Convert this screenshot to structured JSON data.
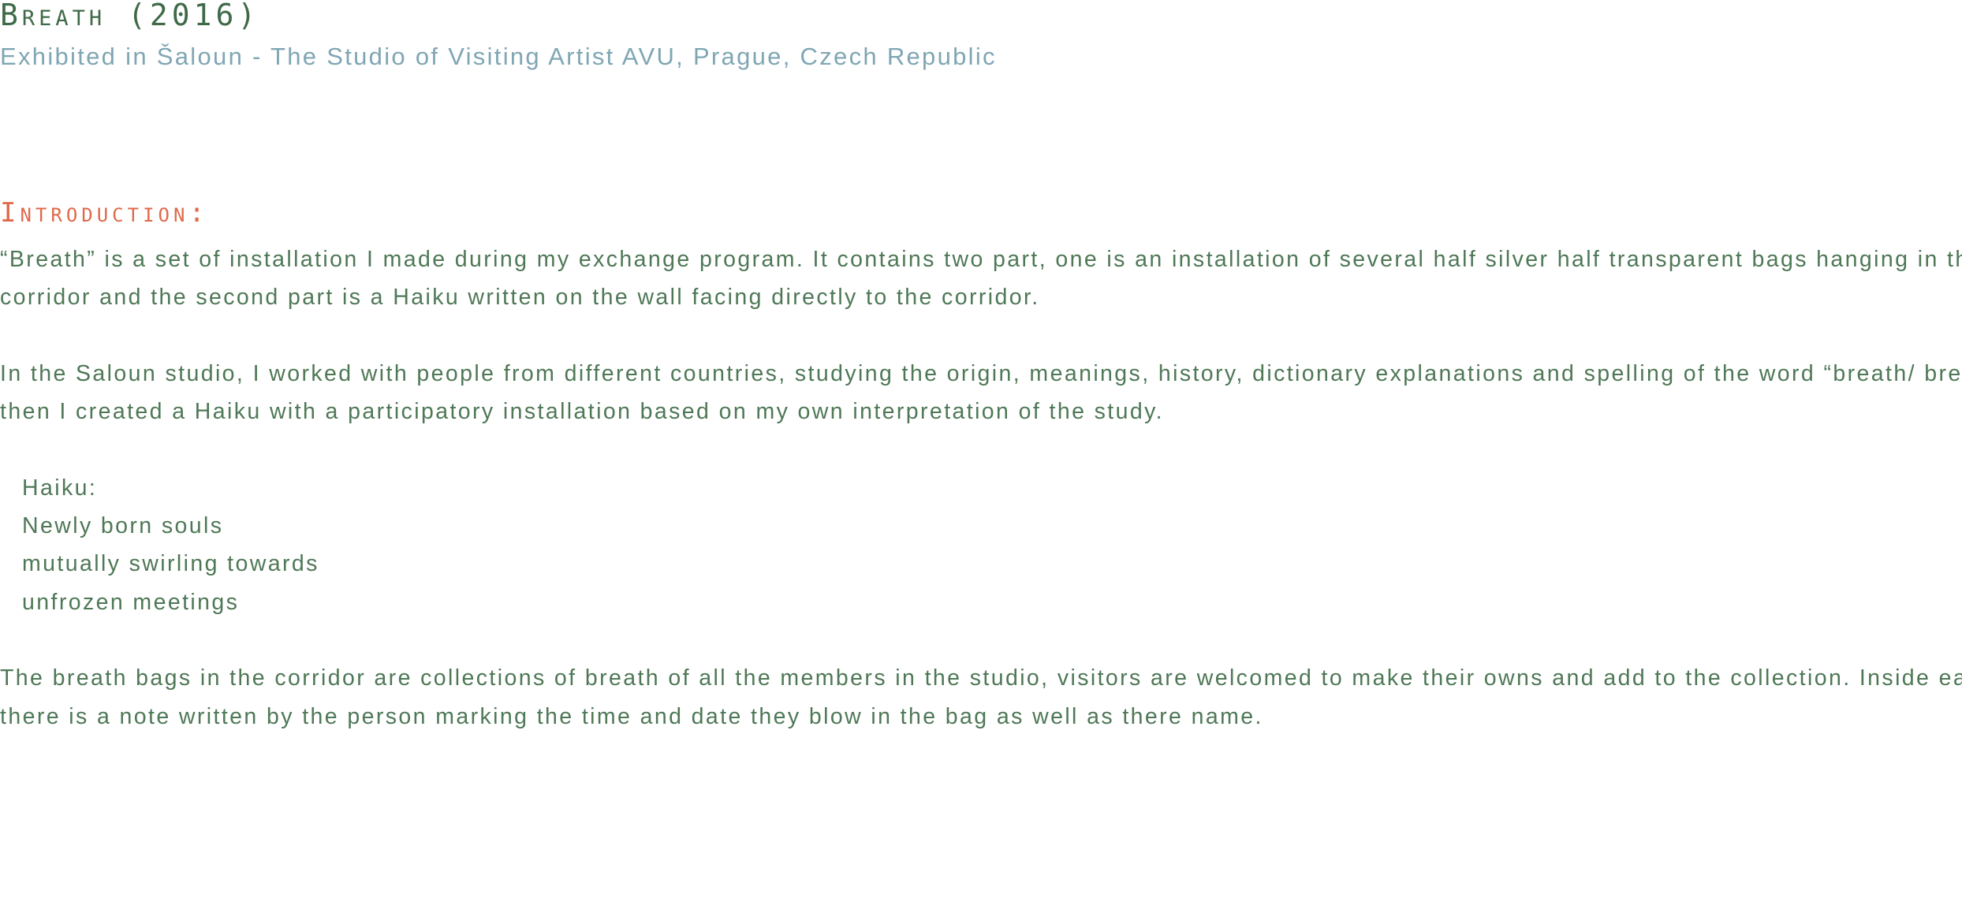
{
  "header": {
    "title": "Breath (2016)",
    "subtitle": "Exhibited in Šaloun - The Studio of Visiting Artist AVU, Prague, Czech Republic"
  },
  "introduction": {
    "heading": "Introduction:",
    "paragraph1": {
      "line1": "“Breath” is a set of installation I made during my exchange program. It contains two part, one is an installation of several half silver half transparent bags hanging in the",
      "line2": "corridor and the second part is a Haiku written on the wall facing directly to the corridor."
    },
    "paragraph2": {
      "line1": "In the Saloun studio, I worked with people from different countries, studying the origin, meanings, history, dictionary explanations and spelling of the word “breath/ breathe”,",
      "line2": "then I created a Haiku with a participatory installation based on my own interpretation of the study."
    },
    "haiku": {
      "label": "Haiku:",
      "line1": "Newly born souls",
      "line2": "mutually swirling towards",
      "line3": "unfrozen meetings"
    },
    "paragraph3": {
      "line1": "The breath bags in the corridor are collections of breath of all the members in the studio, visitors are welcomed to make their owns and add to the collection. Inside each bag,",
      "line2": "there is a note written by the person marking the time and date they blow in the bag as well as there name."
    }
  },
  "colors": {
    "title": "#3f6a48",
    "subtitle": "#7fa6b3",
    "heading": "#e0694a",
    "body": "#4e7856",
    "background": "#ffffff"
  }
}
